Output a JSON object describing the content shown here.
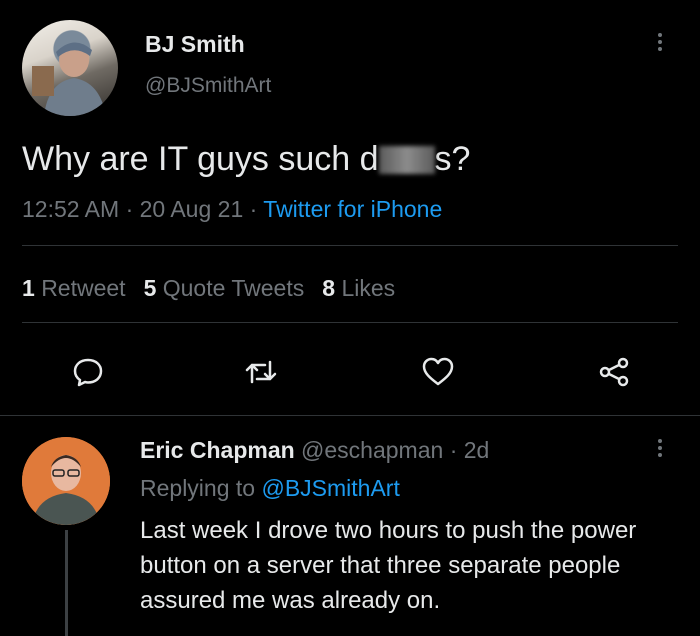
{
  "tweet": {
    "author_name": "BJ Smith",
    "author_handle": "@BJSmithArt",
    "text_before": "Why are IT guys such d",
    "text_after": "s?",
    "time": "12:52 AM",
    "date": "20 Aug 21",
    "source": "Twitter for iPhone",
    "separator": "·"
  },
  "stats": {
    "retweets_count": "1",
    "retweets_label": "Retweet",
    "quotes_count": "5",
    "quotes_label": "Quote Tweets",
    "likes_count": "8",
    "likes_label": "Likes"
  },
  "actions": {
    "icons": [
      "reply-icon",
      "retweet-icon",
      "like-icon",
      "share-icon"
    ]
  },
  "reply": {
    "author_name": "Eric Chapman",
    "author_handle": "@eschapman",
    "age": "2d",
    "replying_label": "Replying to",
    "replying_handle": "@BJSmithArt",
    "text": "Last week I drove two hours to push the power button on a server that three separate people assured me was already on."
  },
  "colors": {
    "background": "#000000",
    "text": "#e7e9ea",
    "muted": "#71767b",
    "link": "#1d9bf0",
    "divider": "#2f3336"
  }
}
